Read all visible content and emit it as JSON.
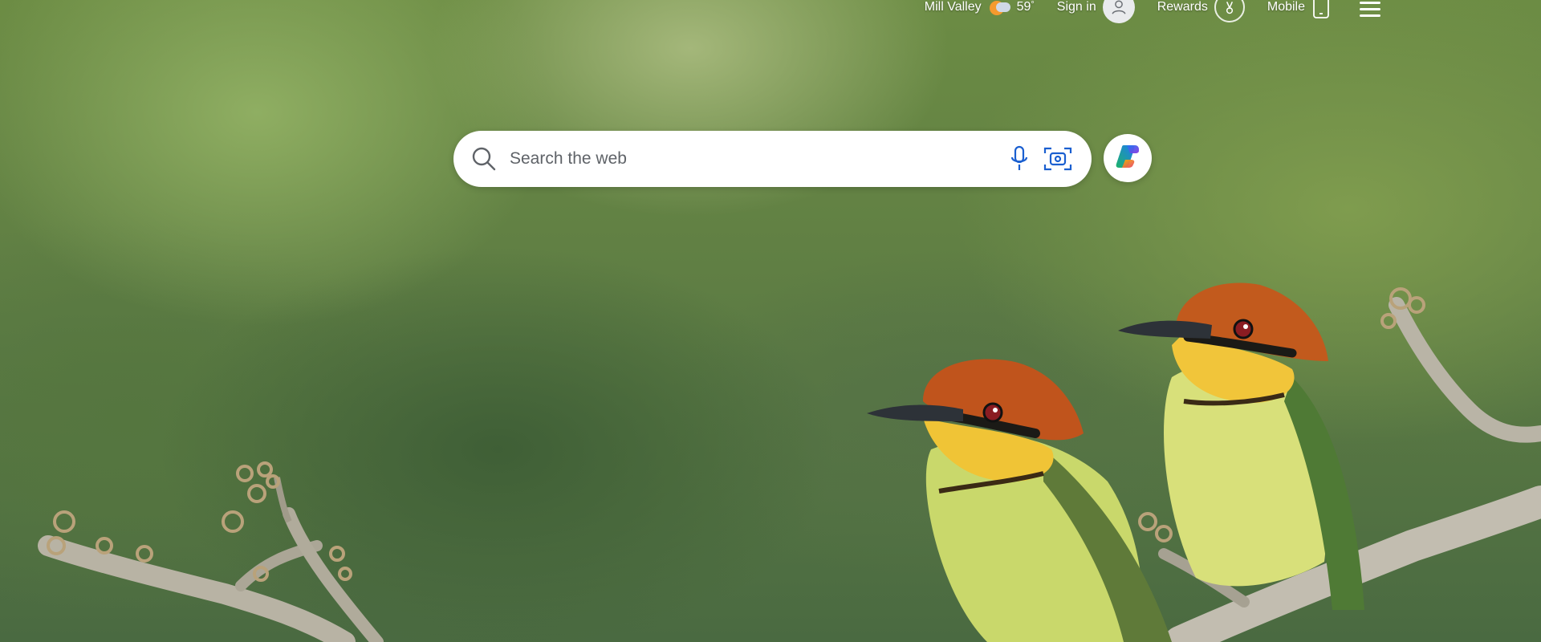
{
  "topbar": {
    "location": "Mill Valley",
    "temperature": "59",
    "temperature_unit": "°",
    "sign_in": "Sign in",
    "rewards": "Rewards",
    "mobile": "Mobile"
  },
  "search": {
    "placeholder": "Search the web"
  },
  "icons": {
    "search": "search-icon",
    "microphone": "microphone-icon",
    "visual_search": "visual-search-icon",
    "copilot": "copilot-icon",
    "weather": "weather-partly-cloudy-icon",
    "user": "user-icon",
    "rewards": "rewards-icon",
    "mobile": "mobile-phone-icon",
    "menu": "hamburger-menu-icon"
  },
  "colors": {
    "search_icon_blue": "#1a5fd0",
    "text_white": "#ffffff"
  }
}
